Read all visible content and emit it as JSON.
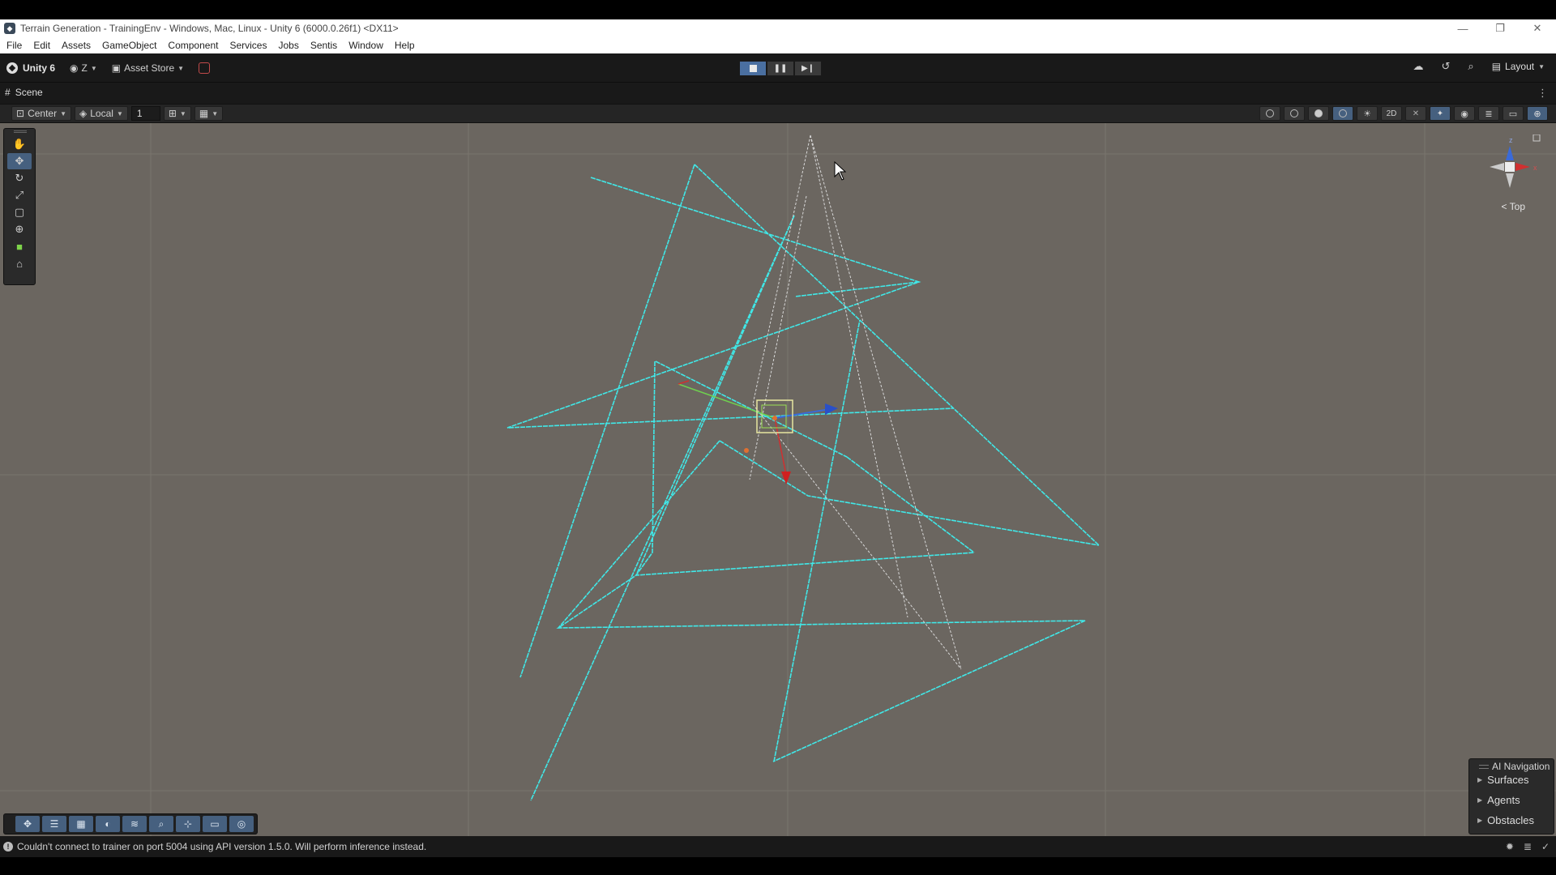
{
  "window": {
    "title": "Terrain Generation - TrainingEnv - Windows, Mac, Linux - Unity 6 (6000.0.26f1) <DX11>",
    "minimize_icon": "minimize-icon",
    "maximize_icon": "restore-icon",
    "close_icon": "close-icon"
  },
  "menubar": {
    "items": [
      "File",
      "Edit",
      "Assets",
      "GameObject",
      "Component",
      "Services",
      "Jobs",
      "Sentis",
      "Window",
      "Help"
    ]
  },
  "main_toolbar": {
    "product": "Unity 6",
    "account_label": "Z",
    "asset_store_label": "Asset Store",
    "layout_label": "Layout",
    "play_state": "playing"
  },
  "scene_tab": {
    "label": "Scene"
  },
  "scene_toolbar": {
    "pivot_label": "Center",
    "space_label": "Local",
    "grid_value": "1"
  },
  "orientation_gizmo": {
    "view_label": "Top",
    "axis_x": "x",
    "axis_z": "z"
  },
  "ai_navigation": {
    "title": "AI Navigation",
    "items": [
      "Surfaces",
      "Agents",
      "Obstacles"
    ]
  },
  "status": {
    "message": "Couldn't connect to trainer on port 5004 using API version 1.5.0. Will perform inference instead."
  },
  "colors": {
    "viewport_bg": "#6b6660",
    "cyan_lines": "#40e8e8",
    "selection_accent": "#46607f"
  }
}
